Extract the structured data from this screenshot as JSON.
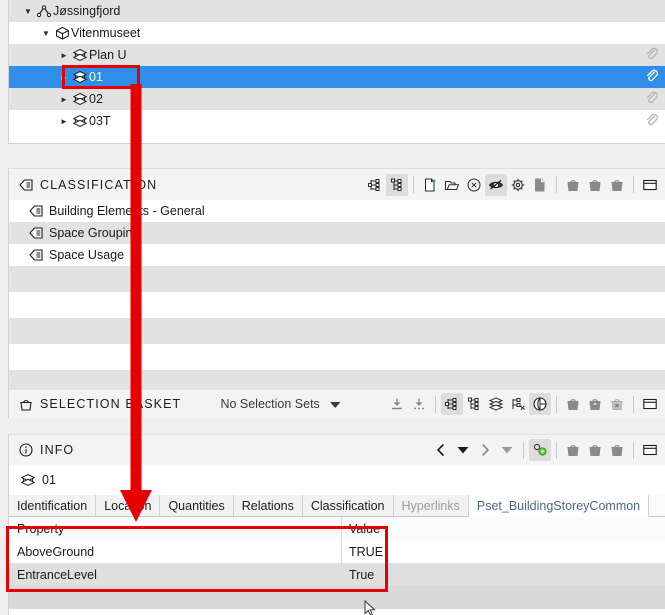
{
  "tree": {
    "rows": [
      {
        "label": "Jøssingfjord",
        "indent": 26,
        "twisty": "▼",
        "icon": "site-icon",
        "state": "alt",
        "clip": false
      },
      {
        "label": "Vitenmuseet",
        "indent": 44,
        "twisty": "▼",
        "icon": "building-icon",
        "state": "plain",
        "clip": false
      },
      {
        "label": "Plan U",
        "indent": 62,
        "twisty": "►",
        "icon": "storey-icon",
        "state": "alt",
        "clip": true
      },
      {
        "label": "01",
        "indent": 62,
        "twisty": "►",
        "icon": "storey-icon",
        "state": "selected",
        "clip": true
      },
      {
        "label": "02",
        "indent": 62,
        "twisty": "►",
        "icon": "storey-icon",
        "state": "alt",
        "clip": true
      },
      {
        "label": "03T",
        "indent": 62,
        "twisty": "►",
        "icon": "storey-icon",
        "state": "plain",
        "clip": true
      }
    ]
  },
  "classification": {
    "title": "CLASSIFICATION",
    "title_icon": "classification-icon",
    "toolbar": [
      {
        "name": "expand-tree-icon",
        "active": false
      },
      {
        "name": "collapse-tree-icon",
        "active": true
      },
      {
        "name": "new-file-icon",
        "active": false
      },
      {
        "name": "open-folder-icon",
        "active": false
      },
      {
        "name": "close-circle-icon",
        "active": false
      },
      {
        "name": "visibility-off-icon",
        "active": true
      },
      {
        "name": "settings-gear-icon",
        "active": false
      },
      {
        "name": "export-page-icon",
        "active": false
      },
      {
        "name": "basket-icon-1",
        "active": false
      },
      {
        "name": "basket-icon-2",
        "active": false
      },
      {
        "name": "basket-icon-3",
        "active": false
      },
      {
        "name": "panel-layout-icon",
        "active": false
      }
    ],
    "items": [
      {
        "label": "Building Elements - General",
        "state": "plain"
      },
      {
        "label": "Space Grouping",
        "state": "alt"
      },
      {
        "label": "Space Usage",
        "state": "plain"
      }
    ],
    "empty_rows": [
      "alt",
      "plain",
      "alt",
      "plain",
      "alt"
    ]
  },
  "selection_basket": {
    "title": "SELECTION BASKET",
    "title_icon": "basket-icon",
    "status_text": "No Selection Sets",
    "dropdown_icon": "caret-down-icon",
    "toolbar": [
      {
        "name": "load-down-icon",
        "active": false
      },
      {
        "name": "save-down-icon",
        "active": false
      },
      {
        "name": "select-tree-icon",
        "active": true
      },
      {
        "name": "hierarchy-icon",
        "active": false
      },
      {
        "name": "layers-icon",
        "active": false
      },
      {
        "name": "select-nodes-icon",
        "active": false
      },
      {
        "name": "sphere-icon",
        "active": true
      },
      {
        "name": "basket-add-icon",
        "active": false
      },
      {
        "name": "basket-remove-icon",
        "active": false
      },
      {
        "name": "basket-clear-icon",
        "active": false
      },
      {
        "name": "panel-layout-icon",
        "active": false
      }
    ]
  },
  "info": {
    "title": "INFO",
    "title_icon": "info-circle-icon",
    "subject_icon": "storey-icon",
    "subject_label": "01",
    "toolbar": [
      {
        "name": "nav-previous-icon",
        "active": false
      },
      {
        "name": "nav-previous-menu-icon",
        "active": false
      },
      {
        "name": "nav-next-icon",
        "active": false
      },
      {
        "name": "nav-next-menu-icon",
        "active": false
      },
      {
        "name": "properties-icon",
        "active": true
      },
      {
        "name": "basket-icon-1",
        "active": false
      },
      {
        "name": "basket-icon-2",
        "active": false
      },
      {
        "name": "basket-icon-3",
        "active": false
      },
      {
        "name": "panel-layout-icon",
        "active": false
      }
    ],
    "tabs": [
      {
        "label": "Identification",
        "state": "normal"
      },
      {
        "label": "Location",
        "state": "normal"
      },
      {
        "label": "Quantities",
        "state": "normal"
      },
      {
        "label": "Relations",
        "state": "normal"
      },
      {
        "label": "Classification",
        "state": "normal"
      },
      {
        "label": "Hyperlinks",
        "state": "disabled"
      },
      {
        "label": "Pset_BuildingStoreyCommon",
        "state": "active"
      }
    ],
    "table": {
      "headers": [
        "Property",
        "Value"
      ],
      "rows": [
        {
          "property": "AboveGround",
          "value": "TRUE",
          "state": "plain"
        },
        {
          "property": "EntranceLevel",
          "value": "True",
          "state": "alt"
        }
      ],
      "empty_rows": [
        "plain"
      ]
    }
  },
  "annotations": {
    "accent_color": "#e60000",
    "selected_row_color": "#2f8ee8",
    "highlight_tree_item": "01",
    "highlight_table": "Pset_BuildingStoreyCommon property table",
    "arrow_from": "tree item 01",
    "arrow_to": "property table"
  }
}
